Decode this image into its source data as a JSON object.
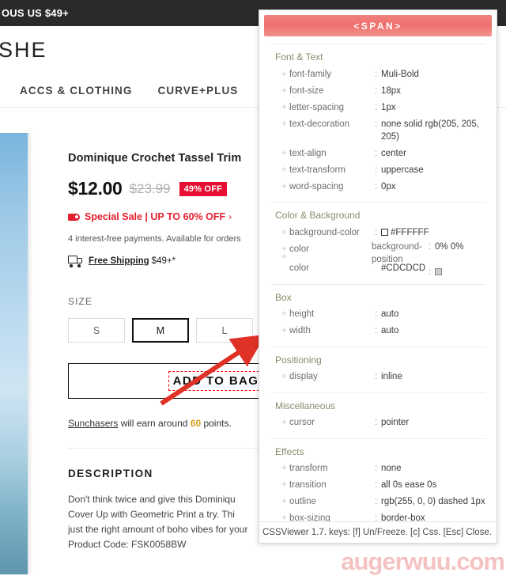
{
  "topbar": {
    "text": "OUS US $49+"
  },
  "header": {
    "logo": "SHE"
  },
  "nav": {
    "items": [
      {
        "label": "ACCS & CLOTHING"
      },
      {
        "label": "CURVE+PLUS"
      },
      {
        "label": ""
      }
    ]
  },
  "product": {
    "title": "Dominique Crochet Tassel Trim",
    "price_now": "$12.00",
    "price_old": "$23.99",
    "discount_badge": "49% OFF",
    "sale_text": "Special Sale | UP TO 60% OFF",
    "sale_chevron": "›",
    "payment_text": "4 interest-free payments. Available for orders",
    "shipping_link": "Free Shipping",
    "shipping_suffix": "$49+*",
    "size_label": "SIZE",
    "sizes": [
      {
        "label": "S",
        "selected": false
      },
      {
        "label": "M",
        "selected": true
      },
      {
        "label": "L",
        "selected": false
      }
    ],
    "add_to_bag": "ADD TO BAG",
    "points_link": "Sunchasers",
    "points_middle": " will earn around ",
    "points_value": "60",
    "points_suffix": " points.",
    "description_title": "DESCRIPTION",
    "description_lines": [
      "Don't think twice and give this Dominiqu",
      "Cover Up with Geometric Print a try. Thi",
      "just the right amount of boho vibes for your",
      "Product Code: FSK0058BW"
    ]
  },
  "cssviewer": {
    "header": "<SPAN>",
    "footer": "CSSViewer 1.7. keys: [f] Un/Freeze. [c] Css. [Esc] Close.",
    "sections": [
      {
        "name": "Font & Text",
        "rows": [
          {
            "prop": "font-family",
            "value": "Muli-Bold"
          },
          {
            "prop": "font-size",
            "value": "18px"
          },
          {
            "prop": "letter-spacing",
            "value": "1px"
          },
          {
            "prop": "text-decoration",
            "value": "none solid rgb(205, 205, 205)"
          },
          {
            "prop": "text-align",
            "value": "center"
          },
          {
            "prop": "text-transform",
            "value": "uppercase"
          },
          {
            "prop": "word-spacing",
            "value": "0px"
          }
        ]
      },
      {
        "name": "Color & Background",
        "rows": [
          {
            "prop": "background-color",
            "value": "#FFFFFF",
            "swatch": "white"
          },
          {
            "prop": "color",
            "value": "#CDCDCD",
            "swatch": "grey"
          }
        ],
        "overlay": [
          {
            "prop": "background-position",
            "value": "0% 0%"
          },
          {
            "prop": "",
            "value": ""
          }
        ]
      },
      {
        "name": "Box",
        "rows": [
          {
            "prop": "height",
            "value": "auto"
          },
          {
            "prop": "width",
            "value": "auto"
          }
        ]
      },
      {
        "name": "Positioning",
        "rows": [
          {
            "prop": "display",
            "value": "inline"
          }
        ]
      },
      {
        "name": "Miscellaneous",
        "rows": [
          {
            "prop": "cursor",
            "value": "pointer"
          }
        ]
      },
      {
        "name": "Effects",
        "rows": [
          {
            "prop": "transform",
            "value": "none"
          },
          {
            "prop": "transition",
            "value": "all 0s ease 0s"
          },
          {
            "prop": "outline",
            "value": "rgb(255, 0, 0) dashed 1px"
          },
          {
            "prop": "box-sizing",
            "value": "border-box"
          }
        ]
      }
    ],
    "colors": {
      "header_accent": "#EF706C",
      "outline_red": "#FF0000"
    }
  },
  "watermark": {
    "text": "augerwuu.com"
  }
}
